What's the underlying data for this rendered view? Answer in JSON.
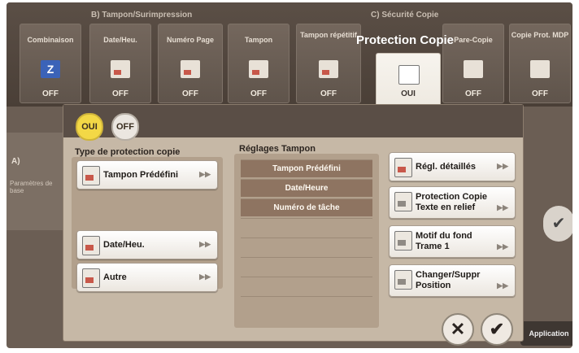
{
  "groups": {
    "b": "B)  Tampon/Surimpression",
    "c": "C)  Sécurité Copie"
  },
  "tabs": [
    {
      "label": "Combinaison",
      "value": "OFF"
    },
    {
      "label": "Date/Heu.",
      "value": "OFF"
    },
    {
      "label": "Numéro Page",
      "value": "OFF"
    },
    {
      "label": "Tampon",
      "value": "OFF"
    },
    {
      "label": "Tampon répétitif",
      "value": "OFF"
    },
    {
      "label": "Protection Copie",
      "value": "OUI"
    },
    {
      "label": "Pare-Copie",
      "value": "OFF"
    },
    {
      "label": "Copie Prot. MDP",
      "value": "OFF"
    }
  ],
  "left_strip": {
    "label": "A)",
    "sub": "Paramètres de base"
  },
  "application_label": "Application",
  "dialog": {
    "toggle_on": "OUI",
    "toggle_off": "OFF",
    "type_title": "Type de protection copie",
    "settings_title": "Réglages Tampon",
    "left_buttons": [
      "Tampon Prédéfini",
      "Date/Heu.",
      "Autre"
    ],
    "list_items": [
      "Tampon Prédéfini",
      "Date/Heure",
      "Numéro de tâche"
    ],
    "right_buttons": [
      {
        "l1": "Régl. détaillés",
        "l2": ""
      },
      {
        "l1": "Protection Copie",
        "l2": "Texte en relief"
      },
      {
        "l1": "Motif du fond",
        "l2": "Trame 1"
      },
      {
        "l1": "Changer/Suppr",
        "l2": "Position"
      }
    ]
  }
}
